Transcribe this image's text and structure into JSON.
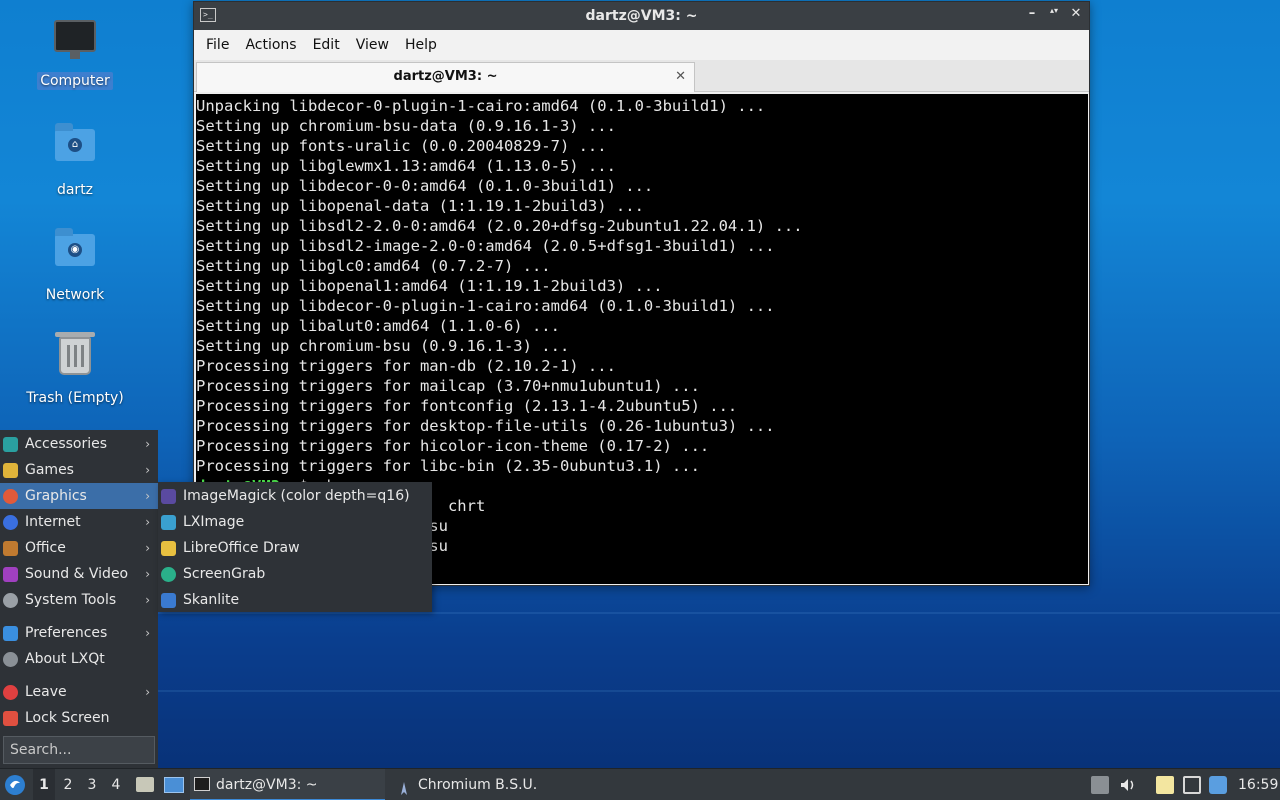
{
  "desktop": {
    "icons": [
      {
        "label": "Computer"
      },
      {
        "label": "dartz"
      },
      {
        "label": "Network"
      },
      {
        "label": "Trash (Empty)"
      }
    ]
  },
  "terminal": {
    "title": "dartz@VM3: ~",
    "app_icon_text": ">_",
    "window_buttons": {
      "minimize": "–",
      "maximize": "▴▾",
      "close": "✕"
    },
    "menu": [
      "File",
      "Actions",
      "Edit",
      "View",
      "Help"
    ],
    "tab": {
      "label": "dartz@VM3: ~",
      "close": "✕"
    },
    "lines": [
      "Unpacking libdecor-0-plugin-1-cairo:amd64 (0.1.0-3build1) ...",
      "Setting up chromium-bsu-data (0.9.16.1-3) ...",
      "Setting up fonts-uralic (0.0.20040829-7) ...",
      "Setting up libglewmx1.13:amd64 (1.13.0-5) ...",
      "Setting up libdecor-0-0:amd64 (0.1.0-3build1) ...",
      "Setting up libopenal-data (1:1.19.1-2build3) ...",
      "Setting up libsdl2-2.0-0:amd64 (2.0.20+dfsg-2ubuntu1.22.04.1) ...",
      "Setting up libsdl2-image-2.0-0:amd64 (2.0.5+dfsg1-3build1) ...",
      "Setting up libglc0:amd64 (0.7.2-7) ...",
      "Setting up libopenal1:amd64 (1:1.19.1-2build3) ...",
      "Setting up libdecor-0-plugin-1-cairo:amd64 (0.1.0-3build1) ...",
      "Setting up libalut0:amd64 (1.1.0-6) ...",
      "Setting up chromium-bsu (0.9.16.1-3) ...",
      "Processing triggers for man-db (2.10.2-1) ...",
      "Processing triggers for mailcap (3.70+nmu1ubuntu1) ...",
      "Processing triggers for fontconfig (2.13.1-4.2ubuntu5) ...",
      "Processing triggers for desktop-file-utils (0.26-1ubuntu3) ...",
      "Processing triggers for hicolor-icon-theme (0.17-2) ...",
      "Processing triggers for libc-bin (2.35-0ubuntu3.1) ..."
    ],
    "prompt_line": {
      "prompt": "dartz@VM3",
      "rest": ":~$ chr"
    },
    "completion_line_1": "                           chrt",
    "completion_line_2": "                         su",
    "completion_line_3": "                         su"
  },
  "start_menu": {
    "items": [
      {
        "label": "Accessories",
        "color": "#2aa0a0"
      },
      {
        "label": "Games",
        "color": "#e0b43a"
      },
      {
        "label": "Graphics",
        "color": "#e05a3a"
      },
      {
        "label": "Internet",
        "color": "#3a6fe0"
      },
      {
        "label": "Office",
        "color": "#c07a30"
      },
      {
        "label": "Sound & Video",
        "color": "#a040c0"
      },
      {
        "label": "System Tools",
        "color": "#9aa0a6"
      }
    ],
    "items2": [
      {
        "label": "Preferences",
        "color": "#3a8fe0"
      },
      {
        "label": "About LXQt",
        "color": "#8a9096"
      }
    ],
    "items3": [
      {
        "label": "Leave",
        "color": "#e04040"
      },
      {
        "label": "Lock Screen",
        "color": "#e05040"
      }
    ],
    "search_placeholder": "Search...",
    "arrow": "›"
  },
  "graphics_submenu": {
    "items": [
      {
        "label": "ImageMagick (color depth=q16)",
        "color": "#5a4aa0"
      },
      {
        "label": "LXImage",
        "color": "#3aa0d0"
      },
      {
        "label": "LibreOffice Draw",
        "color": "#e8c040"
      },
      {
        "label": "ScreenGrab",
        "color": "#2ab08a"
      },
      {
        "label": "Skanlite",
        "color": "#3a7ad0"
      }
    ]
  },
  "taskbar": {
    "desktops": [
      "1",
      "2",
      "3",
      "4"
    ],
    "tasks": [
      {
        "label": "dartz@VM3: ~"
      },
      {
        "label": "Chromium B.S.U."
      }
    ],
    "clock": "16:59",
    "accent": "#3b8ad8"
  }
}
